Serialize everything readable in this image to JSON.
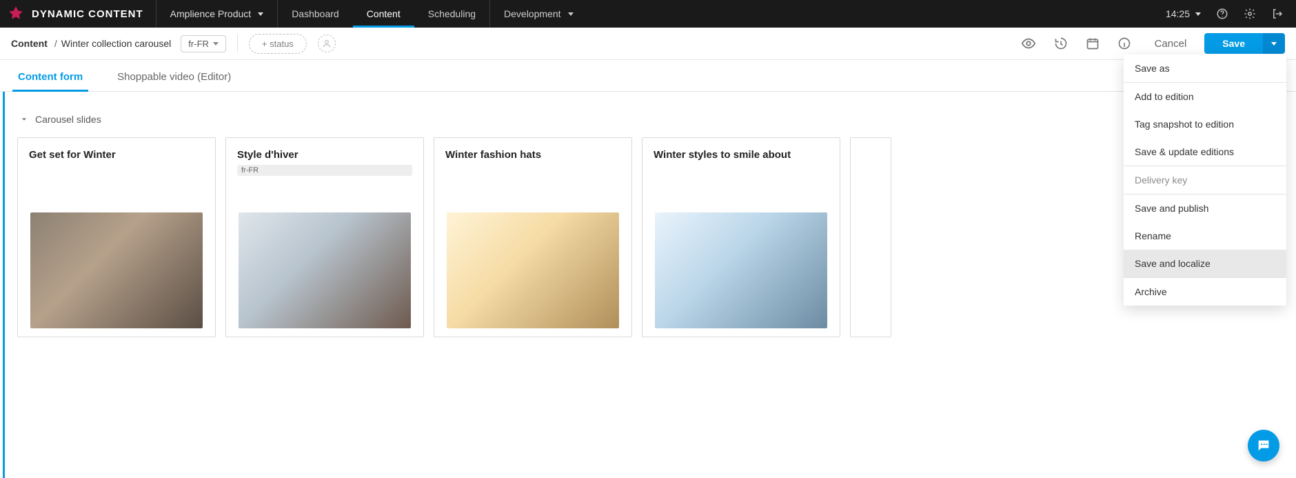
{
  "header": {
    "brand_name": "DYNAMIC CONTENT",
    "org_name": "Amplience Product",
    "nav": [
      {
        "label": "Dashboard",
        "active": false
      },
      {
        "label": "Content",
        "active": true
      },
      {
        "label": "Scheduling",
        "active": false
      }
    ],
    "env_name": "Development",
    "time": "14:25"
  },
  "subbar": {
    "root": "Content",
    "separator": "/",
    "item": "Winter collection carousel",
    "locale": "fr-FR",
    "add_status_label": "+ status",
    "cancel_label": "Cancel",
    "save_label": "Save"
  },
  "tabs": [
    {
      "label": "Content form",
      "active": true
    },
    {
      "label": "Shoppable video (Editor)",
      "active": false
    }
  ],
  "section": {
    "title": "Carousel slides"
  },
  "cards": [
    {
      "title": "Get set for Winter",
      "badge": null,
      "image": "img1"
    },
    {
      "title": "Style d'hiver",
      "badge": "fr-FR",
      "image": "img2"
    },
    {
      "title": "Winter fashion hats",
      "badge": null,
      "image": "img3"
    },
    {
      "title": "Winter styles to smile about",
      "badge": null,
      "image": "img4"
    }
  ],
  "save_menu": [
    {
      "label": "Save as",
      "type": "item"
    },
    {
      "type": "sep"
    },
    {
      "label": "Add to edition",
      "type": "item"
    },
    {
      "label": "Tag snapshot to edition",
      "type": "item"
    },
    {
      "label": "Save & update editions",
      "type": "item"
    },
    {
      "type": "sep"
    },
    {
      "label": "Delivery key",
      "type": "disabled"
    },
    {
      "type": "sep"
    },
    {
      "label": "Save and publish",
      "type": "item"
    },
    {
      "label": "Rename",
      "type": "item"
    },
    {
      "label": "Save and localize",
      "type": "highlight"
    },
    {
      "type": "sep"
    },
    {
      "label": "Archive",
      "type": "item"
    }
  ]
}
